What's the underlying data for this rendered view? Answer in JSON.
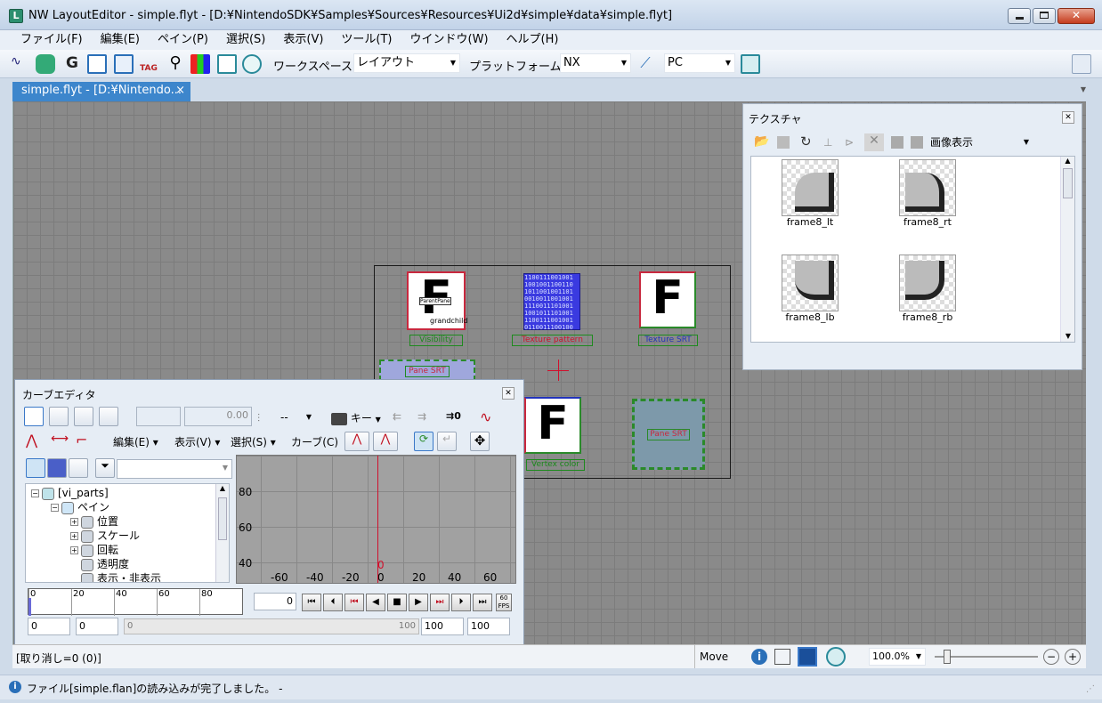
{
  "window": {
    "title": "NW LayoutEditor - simple.flyt - [D:¥NintendoSDK¥Samples¥Sources¥Resources¥Ui2d¥simple¥data¥simple.flyt]",
    "app_icon_letter": "L"
  },
  "menu": [
    "ファイル(F)",
    "編集(E)",
    "ペイン(P)",
    "選択(S)",
    "表示(V)",
    "ツール(T)",
    "ウインドウ(W)",
    "ヘルプ(H)"
  ],
  "toolbar": {
    "workspace_label": "ワークスペース",
    "workspace_value": "レイアウト",
    "platform_label": "プラットフォーム",
    "platform_value": "NX",
    "target_value": "PC",
    "icons": [
      "anim-icon",
      "face-icon",
      "g-icon",
      "tree-icon",
      "frame-icon",
      "tag-icon",
      "search-icon",
      "color-icon",
      "pane-icon",
      "parts-icon"
    ]
  },
  "doc_tab": {
    "label": "simple.flyt - [D:¥Nintendo...",
    "close": "×"
  },
  "layout_panes": {
    "pane1_label": "Visibility",
    "pane1_sub": "grandchild",
    "pane1_small": "ParentPane",
    "pane2_label": "Texture pattern",
    "pane2_text": [
      "1100111001001",
      "1001001100110",
      "1011001001101",
      "0010011001001",
      "1110011101001",
      "1001011101001",
      "1100111001001",
      "0110011100100"
    ],
    "pane3_label": "Texture SRT",
    "pane4_label": "Pane SRT",
    "pane5_label": "Vertex color",
    "pane6_label": "Pane SRT",
    "letter": "F"
  },
  "texture_panel": {
    "title": "テクスチャ",
    "view_mode": "画像表示",
    "items": [
      {
        "name": "frame8_lt"
      },
      {
        "name": "frame8_rt"
      },
      {
        "name": "frame8_lb"
      },
      {
        "name": "frame8_rb"
      }
    ]
  },
  "curve_editor": {
    "title": "カーブエディタ",
    "value_field": "0.00",
    "interp_select": "--",
    "key_label": "キー",
    "menu_edit": "編集(E)",
    "menu_view": "表示(V)",
    "menu_select": "選択(S)",
    "menu_curve": "カーブ(C)",
    "graph_y_labels": [
      "80",
      "60",
      "40"
    ],
    "graph_x_labels": [
      "-60",
      "-40",
      "-20",
      "0",
      "20",
      "40",
      "60"
    ],
    "cursor_frame": "0",
    "tree": [
      {
        "label": "[vi_parts]",
        "level": 0
      },
      {
        "label": "ペイン",
        "level": 1
      },
      {
        "label": "位置",
        "level": 2
      },
      {
        "label": "スケール",
        "level": 2
      },
      {
        "label": "回転",
        "level": 2
      },
      {
        "label": "透明度",
        "level": 2
      },
      {
        "label": "表示・非表示",
        "level": 2
      }
    ],
    "timeline_labels": [
      "0",
      "20",
      "40",
      "60",
      "80"
    ],
    "current_frame": "0",
    "fps_label": "60 FPS",
    "range_start": "0",
    "range_start2": "0",
    "range_slider_start": "0",
    "range_slider_end": "100",
    "range_end": "100",
    "range_end2": "100"
  },
  "status": {
    "undo": "[取り消し=0 (0)]",
    "mode": "Move",
    "zoom": "100.0%",
    "message": "ファイル[simple.flan]の読み込みが完了しました。 -"
  },
  "colors": {
    "tab_active": "#3d86cc",
    "canvas_bg": "#8a8a8a",
    "pane_border": "#2a8a2a",
    "cursor_line": "#d0102c"
  }
}
